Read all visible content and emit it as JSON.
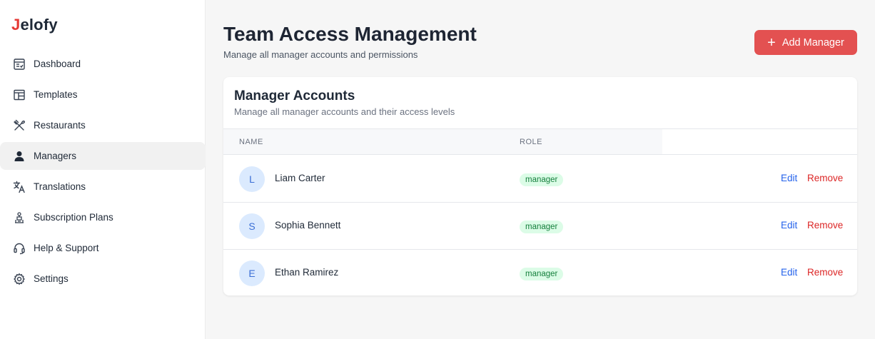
{
  "app": {
    "logo_initial": "J",
    "logo_rest": "elofy"
  },
  "sidebar": {
    "items": [
      {
        "label": "Dashboard",
        "icon": "dashboard-icon"
      },
      {
        "label": "Templates",
        "icon": "templates-icon"
      },
      {
        "label": "Restaurants",
        "icon": "utensils-icon"
      },
      {
        "label": "Managers",
        "icon": "user-icon",
        "active": true
      },
      {
        "label": "Translations",
        "icon": "translate-icon"
      },
      {
        "label": "Subscription Plans",
        "icon": "subscription-icon"
      },
      {
        "label": "Help & Support",
        "icon": "headset-icon"
      },
      {
        "label": "Settings",
        "icon": "gear-icon"
      }
    ]
  },
  "header": {
    "title": "Team Access Management",
    "subtitle": "Manage all manager accounts and permissions",
    "add_button": "Add Manager"
  },
  "card": {
    "title": "Manager Accounts",
    "subtitle": "Manage all manager accounts and their access levels",
    "columns": [
      "NAME",
      "ROLE"
    ],
    "rows": [
      {
        "initial": "L",
        "name": "Liam Carter",
        "role": "manager",
        "edit": "Edit",
        "remove": "Remove"
      },
      {
        "initial": "S",
        "name": "Sophia Bennett",
        "role": "manager",
        "edit": "Edit",
        "remove": "Remove"
      },
      {
        "initial": "E",
        "name": "Ethan Ramirez",
        "role": "manager",
        "edit": "Edit",
        "remove": "Remove"
      }
    ]
  },
  "colors": {
    "accent": "#e35151",
    "link": "#2563eb",
    "danger": "#dc2626",
    "badge_bg": "#dcfce7",
    "badge_text": "#15803d"
  }
}
